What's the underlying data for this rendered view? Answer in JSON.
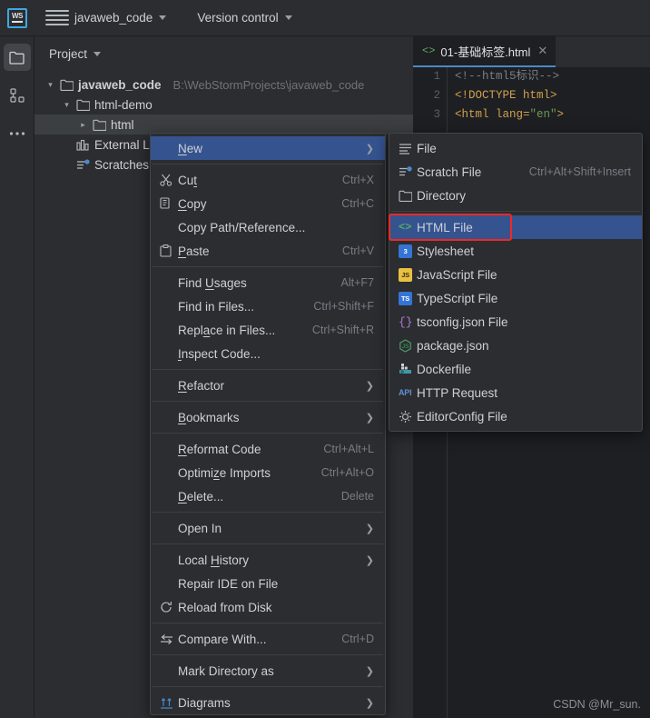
{
  "topbar": {
    "logo_text": "WS",
    "menu_icon": "hamburger-icon",
    "project_name": "javaweb_code",
    "version_control": "Version control"
  },
  "activity_bar": {
    "items": [
      {
        "name": "project-icon",
        "selected": true
      },
      {
        "name": "structure-icon",
        "selected": false
      },
      {
        "name": "more-icon",
        "selected": false
      }
    ]
  },
  "project_panel": {
    "title": "Project",
    "tree": [
      {
        "label": "javaweb_code",
        "path": "B:\\WebStormProjects\\javaweb_code",
        "arrow": "expanded",
        "indent": 0,
        "bold": true,
        "icon": "folder-icon",
        "selected": false
      },
      {
        "label": "html-demo",
        "path": "",
        "arrow": "expanded",
        "indent": 1,
        "bold": false,
        "icon": "folder-icon",
        "selected": false
      },
      {
        "label": "html",
        "path": "",
        "arrow": "collapsed",
        "indent": 2,
        "bold": false,
        "icon": "folder-icon",
        "selected": true
      },
      {
        "label": "External Li",
        "path": "",
        "arrow": "none",
        "indent": 1,
        "bold": false,
        "icon": "library-icon",
        "selected": false
      },
      {
        "label": "Scratches",
        "path": "",
        "arrow": "none",
        "indent": 1,
        "bold": false,
        "icon": "scratches-icon",
        "selected": false
      }
    ]
  },
  "editor": {
    "tab_label": "01-基础标签.html",
    "tab_icon": "html-code-icon",
    "close_icon": "close-icon",
    "line_numbers": [
      "1",
      "2",
      "3"
    ],
    "lines": [
      {
        "parts": [
          {
            "text": "<!--html5标识-->",
            "style": "comment"
          }
        ]
      },
      {
        "parts": [
          {
            "text": "<!DOCTYPE html>",
            "style": "doctype"
          }
        ]
      },
      {
        "parts": [
          {
            "text": "<html lang=",
            "style": "tag"
          },
          {
            "text": "\"en\"",
            "style": "val"
          },
          {
            "text": ">",
            "style": "tag"
          }
        ]
      }
    ]
  },
  "context_menu": {
    "items": [
      {
        "label": "New",
        "mnemonic": "N",
        "shortcut": "",
        "icon": "",
        "arrow": true,
        "highlighted": true,
        "sep_after": true
      },
      {
        "label": "Cut",
        "mnemonic": "t",
        "shortcut": "Ctrl+X",
        "icon": "cut-icon",
        "arrow": false,
        "highlighted": false,
        "sep_after": false
      },
      {
        "label": "Copy",
        "mnemonic": "C",
        "shortcut": "Ctrl+C",
        "icon": "copy-icon",
        "arrow": false,
        "highlighted": false,
        "sep_after": false
      },
      {
        "label": "Copy Path/Reference...",
        "mnemonic": "",
        "shortcut": "",
        "icon": "",
        "arrow": false,
        "highlighted": false,
        "sep_after": false
      },
      {
        "label": "Paste",
        "mnemonic": "P",
        "shortcut": "Ctrl+V",
        "icon": "paste-icon",
        "arrow": false,
        "highlighted": false,
        "sep_after": true
      },
      {
        "label": "Find Usages",
        "mnemonic": "U",
        "shortcut": "Alt+F7",
        "icon": "",
        "arrow": false,
        "highlighted": false,
        "sep_after": false
      },
      {
        "label": "Find in Files...",
        "mnemonic": "",
        "shortcut": "Ctrl+Shift+F",
        "icon": "",
        "arrow": false,
        "highlighted": false,
        "sep_after": false
      },
      {
        "label": "Replace in Files...",
        "mnemonic": "a",
        "shortcut": "Ctrl+Shift+R",
        "icon": "",
        "arrow": false,
        "highlighted": false,
        "sep_after": false
      },
      {
        "label": "Inspect Code...",
        "mnemonic": "I",
        "shortcut": "",
        "icon": "",
        "arrow": false,
        "highlighted": false,
        "sep_after": true
      },
      {
        "label": "Refactor",
        "mnemonic": "R",
        "shortcut": "",
        "icon": "",
        "arrow": true,
        "highlighted": false,
        "sep_after": true
      },
      {
        "label": "Bookmarks",
        "mnemonic": "B",
        "shortcut": "",
        "icon": "",
        "arrow": true,
        "highlighted": false,
        "sep_after": true
      },
      {
        "label": "Reformat Code",
        "mnemonic": "R",
        "shortcut": "Ctrl+Alt+L",
        "icon": "",
        "arrow": false,
        "highlighted": false,
        "sep_after": false
      },
      {
        "label": "Optimize Imports",
        "mnemonic": "z",
        "shortcut": "Ctrl+Alt+O",
        "icon": "",
        "arrow": false,
        "highlighted": false,
        "sep_after": false
      },
      {
        "label": "Delete...",
        "mnemonic": "D",
        "shortcut": "Delete",
        "icon": "",
        "arrow": false,
        "highlighted": false,
        "sep_after": true
      },
      {
        "label": "Open In",
        "mnemonic": "",
        "shortcut": "",
        "icon": "",
        "arrow": true,
        "highlighted": false,
        "sep_after": true
      },
      {
        "label": "Local History",
        "mnemonic": "H",
        "shortcut": "",
        "icon": "",
        "arrow": true,
        "highlighted": false,
        "sep_after": false
      },
      {
        "label": "Repair IDE on File",
        "mnemonic": "",
        "shortcut": "",
        "icon": "",
        "arrow": false,
        "highlighted": false,
        "sep_after": false
      },
      {
        "label": "Reload from Disk",
        "mnemonic": "",
        "shortcut": "",
        "icon": "reload-icon",
        "arrow": false,
        "highlighted": false,
        "sep_after": true
      },
      {
        "label": "Compare With...",
        "mnemonic": "",
        "shortcut": "Ctrl+D",
        "icon": "compare-icon",
        "arrow": false,
        "highlighted": false,
        "sep_after": true
      },
      {
        "label": "Mark Directory as",
        "mnemonic": "",
        "shortcut": "",
        "icon": "",
        "arrow": true,
        "highlighted": false,
        "sep_after": true
      },
      {
        "label": "Diagrams",
        "mnemonic": "",
        "shortcut": "",
        "icon": "diagrams-icon",
        "arrow": true,
        "highlighted": false,
        "sep_after": false
      }
    ]
  },
  "submenu": {
    "items": [
      {
        "label": "File",
        "shortcut": "",
        "icon": "file-icon",
        "highlighted": false,
        "sep_after": false
      },
      {
        "label": "Scratch File",
        "shortcut": "Ctrl+Alt+Shift+Insert",
        "icon": "scratch-file-icon",
        "highlighted": false,
        "sep_after": false
      },
      {
        "label": "Directory",
        "shortcut": "",
        "icon": "directory-icon",
        "highlighted": false,
        "sep_after": true
      },
      {
        "label": "HTML File",
        "shortcut": "",
        "icon": "html-file-icon",
        "highlighted": true,
        "sep_after": false
      },
      {
        "label": "Stylesheet",
        "shortcut": "",
        "icon": "stylesheet-icon",
        "highlighted": false,
        "sep_after": false
      },
      {
        "label": "JavaScript File",
        "shortcut": "",
        "icon": "javascript-file-icon",
        "highlighted": false,
        "sep_after": false
      },
      {
        "label": "TypeScript File",
        "shortcut": "",
        "icon": "typescript-file-icon",
        "highlighted": false,
        "sep_after": false
      },
      {
        "label": "tsconfig.json File",
        "shortcut": "",
        "icon": "tsconfig-icon",
        "highlighted": false,
        "sep_after": false
      },
      {
        "label": "package.json",
        "shortcut": "",
        "icon": "package-json-icon",
        "highlighted": false,
        "sep_after": false
      },
      {
        "label": "Dockerfile",
        "shortcut": "",
        "icon": "dockerfile-icon",
        "highlighted": false,
        "sep_after": false
      },
      {
        "label": "HTTP Request",
        "shortcut": "",
        "icon": "http-request-icon",
        "highlighted": false,
        "sep_after": false
      },
      {
        "label": "EditorConfig File",
        "shortcut": "",
        "icon": "editorconfig-icon",
        "highlighted": false,
        "sep_after": false
      }
    ]
  },
  "watermark": "CSDN @Mr_sun.",
  "colors": {
    "bg": "#1e1f22",
    "panel": "#2b2d30",
    "menu_bg": "#2b2d30",
    "highlight": "#35538f",
    "accent_red": "#ee2a23",
    "tab_underline": "#4a88c7",
    "text": "#ced0d6",
    "muted": "#787c84"
  }
}
